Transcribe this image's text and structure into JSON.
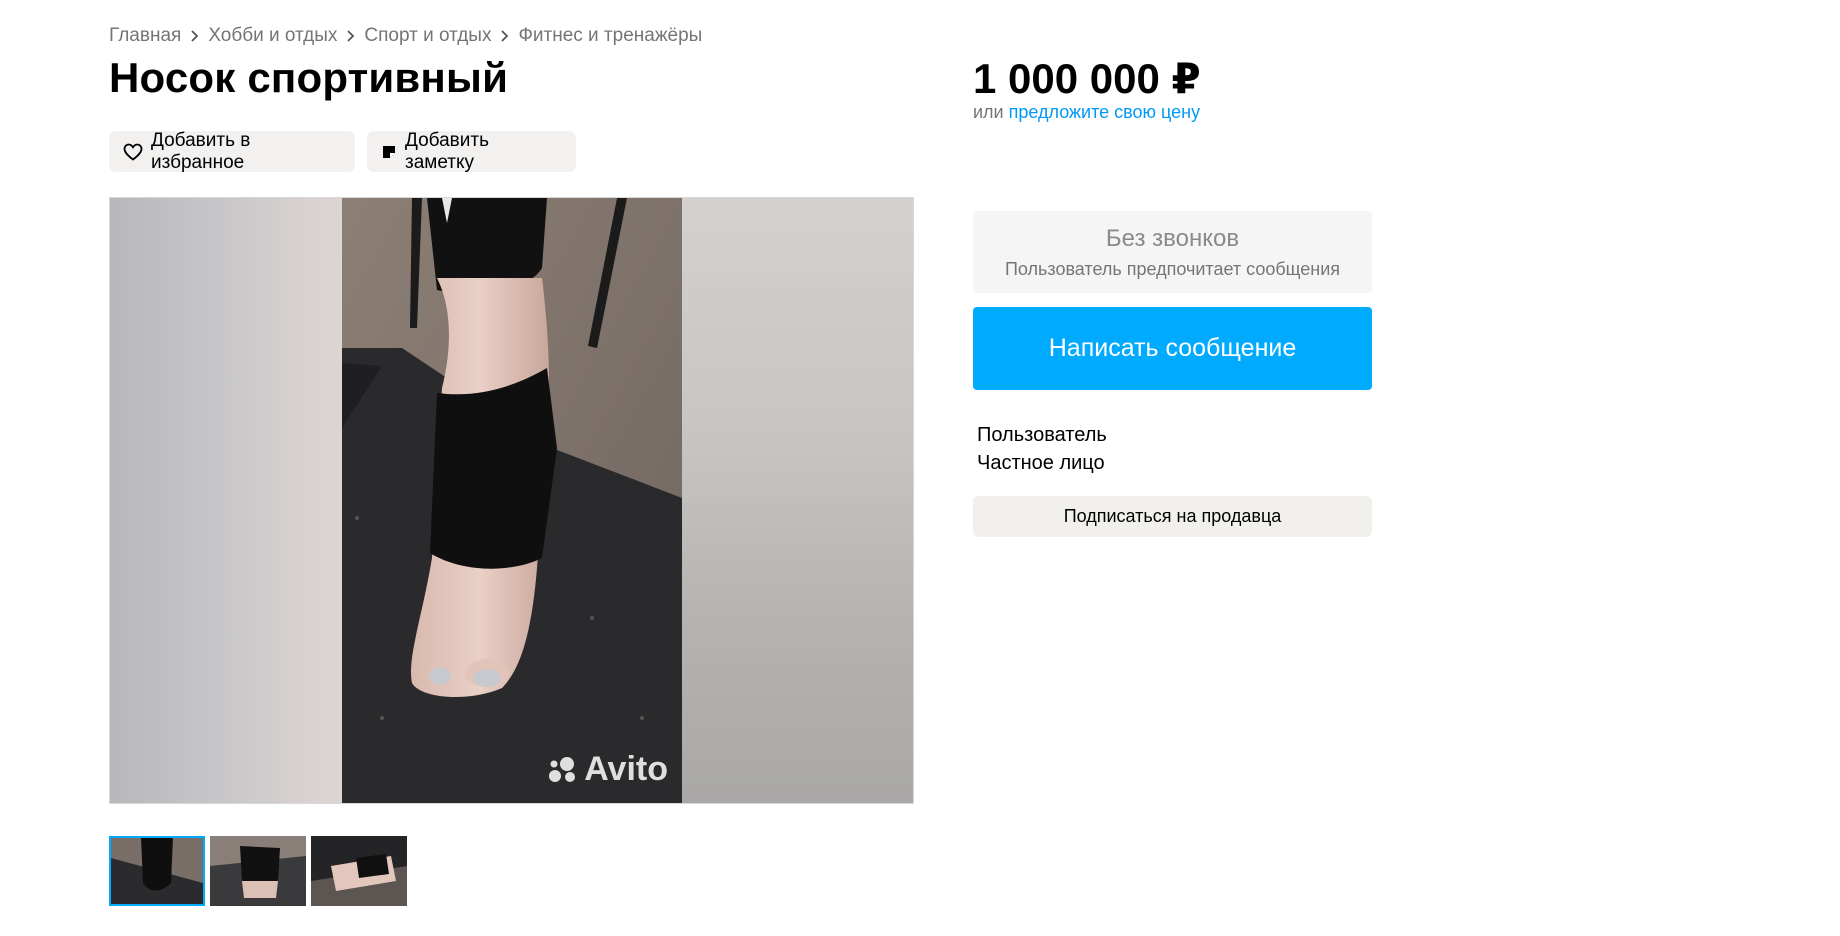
{
  "breadcrumb": [
    "Главная",
    "Хобби и отдых",
    "Спорт и отдых",
    "Фитнес и тренажёры"
  ],
  "listing": {
    "title": "Носок спортивный",
    "favorite_label": "Добавить в избранное",
    "note_label": "Добавить заметку"
  },
  "price": {
    "value": "1 000 000 ₽",
    "or_text": "или ",
    "offer_link": "предложите свою цену"
  },
  "contact": {
    "no_calls_title": "Без звонков",
    "no_calls_subtitle": "Пользователь предпочитает сообщения",
    "message_button": "Написать сообщение"
  },
  "seller": {
    "name": "Пользователь",
    "type": "Частное лицо",
    "subscribe_button": "Подписаться на продавца"
  },
  "gallery": {
    "watermark": "Avito",
    "thumbnail_count": 3,
    "active_thumbnail": 1
  },
  "icons": {
    "favorite": "heart-icon",
    "note": "note-icon",
    "breadcrumb_separator": "chevron-right-icon"
  },
  "colors": {
    "accent": "#00aaff",
    "link": "#0099f7",
    "pill_bg": "#f2f1f0"
  }
}
